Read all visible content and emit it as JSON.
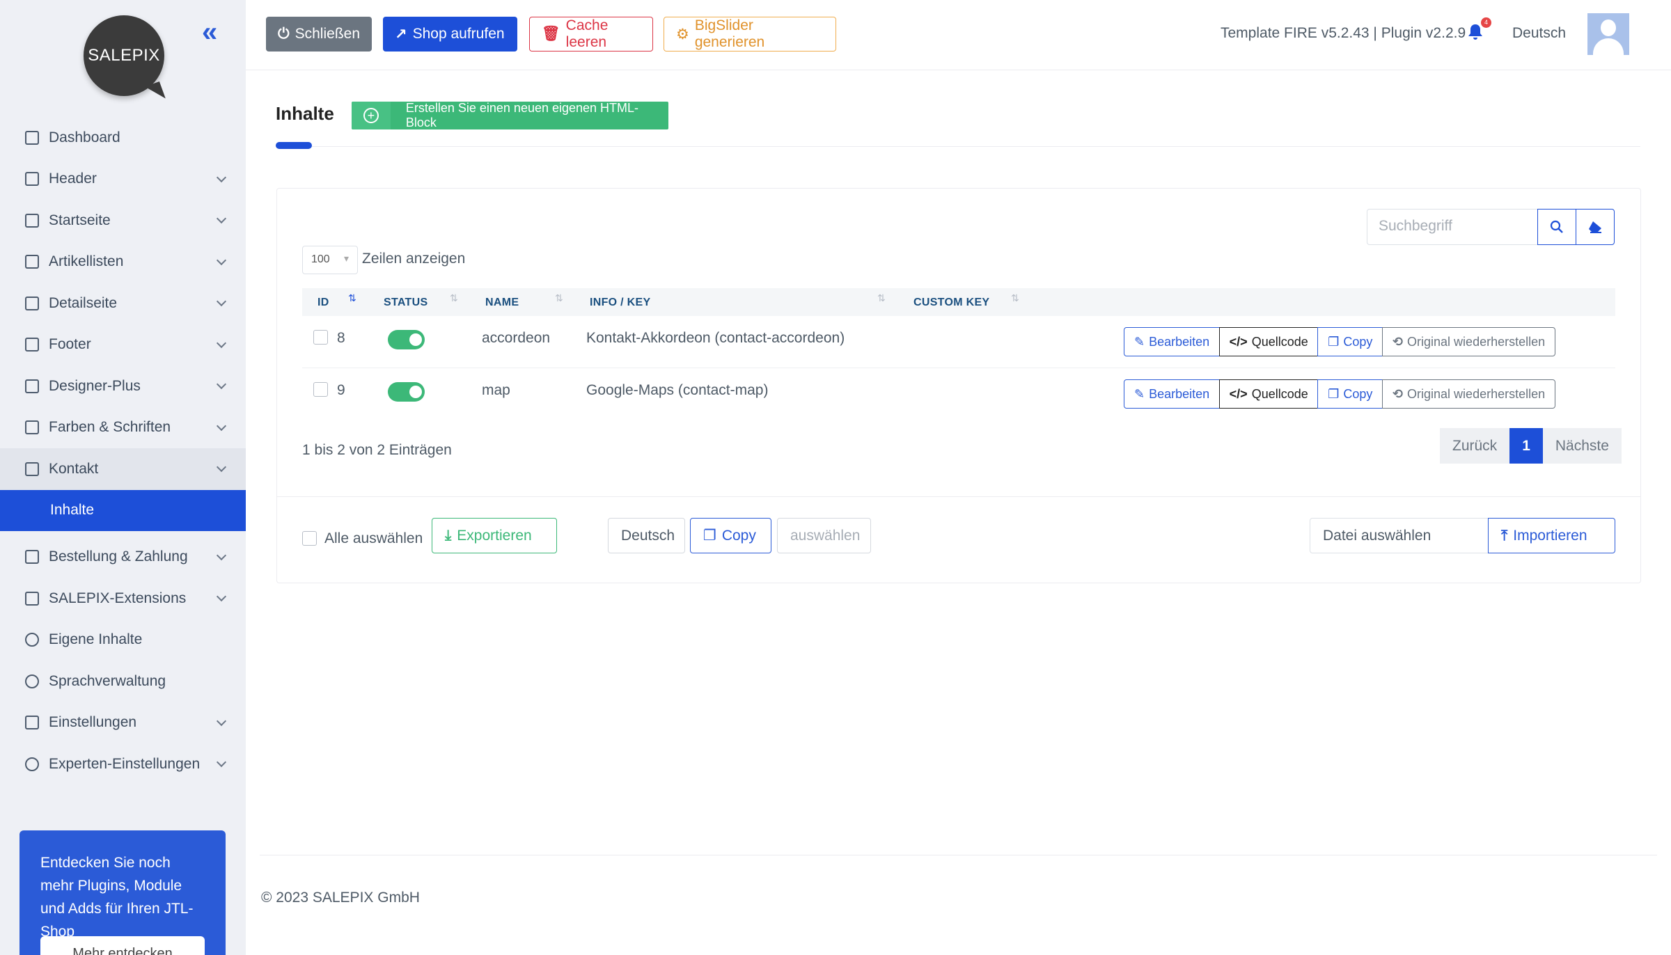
{
  "sidebar": {
    "logo_text": "SALEPIX",
    "items": [
      {
        "label": "Dashboard"
      },
      {
        "label": "Header"
      },
      {
        "label": "Startseite"
      },
      {
        "label": "Artikellisten"
      },
      {
        "label": "Detailseite"
      },
      {
        "label": "Footer"
      },
      {
        "label": "Designer-Plus"
      },
      {
        "label": "Farben & Schriften"
      },
      {
        "label": "Kontakt"
      },
      {
        "label": "Inhalte"
      },
      {
        "label": "Bestellung & Zahlung"
      },
      {
        "label": "SALEPIX-Extensions"
      },
      {
        "label": "Eigene Inhalte"
      },
      {
        "label": "Sprachverwaltung"
      },
      {
        "label": "Einstellungen"
      },
      {
        "label": "Experten-Einstellungen"
      }
    ],
    "promo_text": "Entdecken Sie noch mehr Plugins, Module und Adds für Ihren JTL-Shop",
    "promo_button": "Mehr entdecken"
  },
  "toolbar": {
    "close": "Schließen",
    "shop": "Shop aufrufen",
    "cache": "Cache leeren",
    "slider": "BigSlider generieren",
    "version": "Template FIRE v5.2.43 | Plugin v2.2.9",
    "notification_count": "4",
    "language": "Deutsch"
  },
  "page": {
    "title": "Inhalte",
    "create_button": "Erstellen Sie einen neuen eigenen HTML-Block"
  },
  "table": {
    "search_placeholder": "Suchbegriff",
    "page_size": "100",
    "page_size_label": "Zeilen anzeigen",
    "columns": [
      "ID",
      "STATUS",
      "NAME",
      "INFO / KEY",
      "CUSTOM KEY"
    ],
    "rows": [
      {
        "id": "8",
        "name": "accordeon",
        "info": "Kontakt-Akkordeon (contact-accordeon)",
        "custom_key": ""
      },
      {
        "id": "9",
        "name": "map",
        "info": "Google-Maps (contact-map)",
        "custom_key": ""
      }
    ],
    "row_actions": {
      "edit": "Bearbeiten",
      "source": "Quellcode",
      "copy": "Copy",
      "restore": "Original wiederherstellen"
    },
    "info": "1 bis 2 von 2 Einträgen",
    "pager": {
      "prev": "Zurück",
      "current": "1",
      "next": "Nächste"
    }
  },
  "footer_actions": {
    "select_all": "Alle auswählen",
    "export": "Exportieren",
    "language": "Deutsch",
    "copy": "Copy",
    "select": "auswählen",
    "file": "Datei auswählen",
    "import": "Importieren"
  },
  "copyright": "© 2023 SALEPIX GmbH",
  "colors": {
    "primary": "#1d4fd8",
    "success": "#3cb878",
    "danger": "#dc3545",
    "warning": "#f0ad4e",
    "secondary": "#6b7580"
  }
}
